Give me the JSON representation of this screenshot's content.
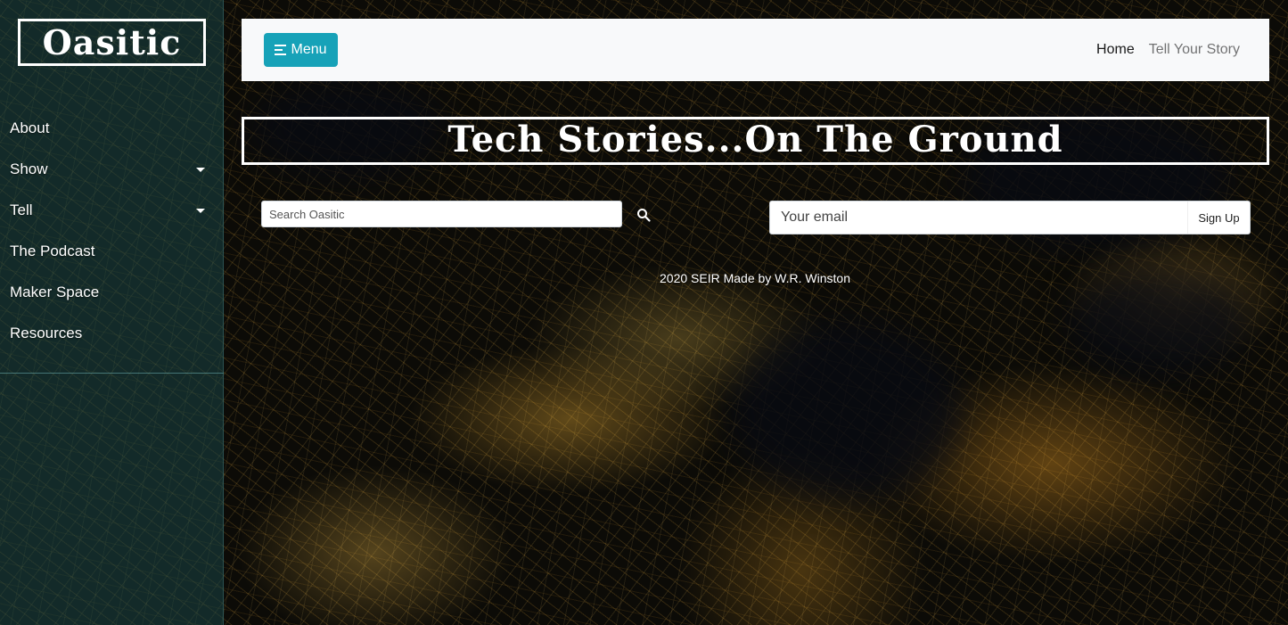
{
  "brand": {
    "logo_text": "Oasitic"
  },
  "sidebar": {
    "items": [
      {
        "label": "About",
        "has_dropdown": false
      },
      {
        "label": "Show",
        "has_dropdown": true
      },
      {
        "label": "Tell",
        "has_dropdown": true
      },
      {
        "label": "The Podcast",
        "has_dropdown": false
      },
      {
        "label": "Maker Space",
        "has_dropdown": false
      },
      {
        "label": "Resources",
        "has_dropdown": false
      }
    ]
  },
  "navbar": {
    "menu_button_label": "Menu",
    "menu_icon": "hamburger-menu-icon",
    "links": [
      {
        "label": "Home",
        "active": true
      },
      {
        "label": "Tell Your Story",
        "active": false
      }
    ]
  },
  "hero": {
    "title": "Tech Stories...On The Ground"
  },
  "search": {
    "placeholder": "Search Oasitic",
    "value": "",
    "icon": "search-icon"
  },
  "signup": {
    "email_placeholder": "Your email",
    "email_value": "",
    "button_label": "Sign Up"
  },
  "footer": {
    "credit": "2020 SEIR Made by W.R. Winston"
  },
  "colors": {
    "menu_button": "#17a2b8",
    "navbar_bg": "#f8f9fa",
    "sidebar_bg": "rgba(25,70,70,0.55)"
  }
}
